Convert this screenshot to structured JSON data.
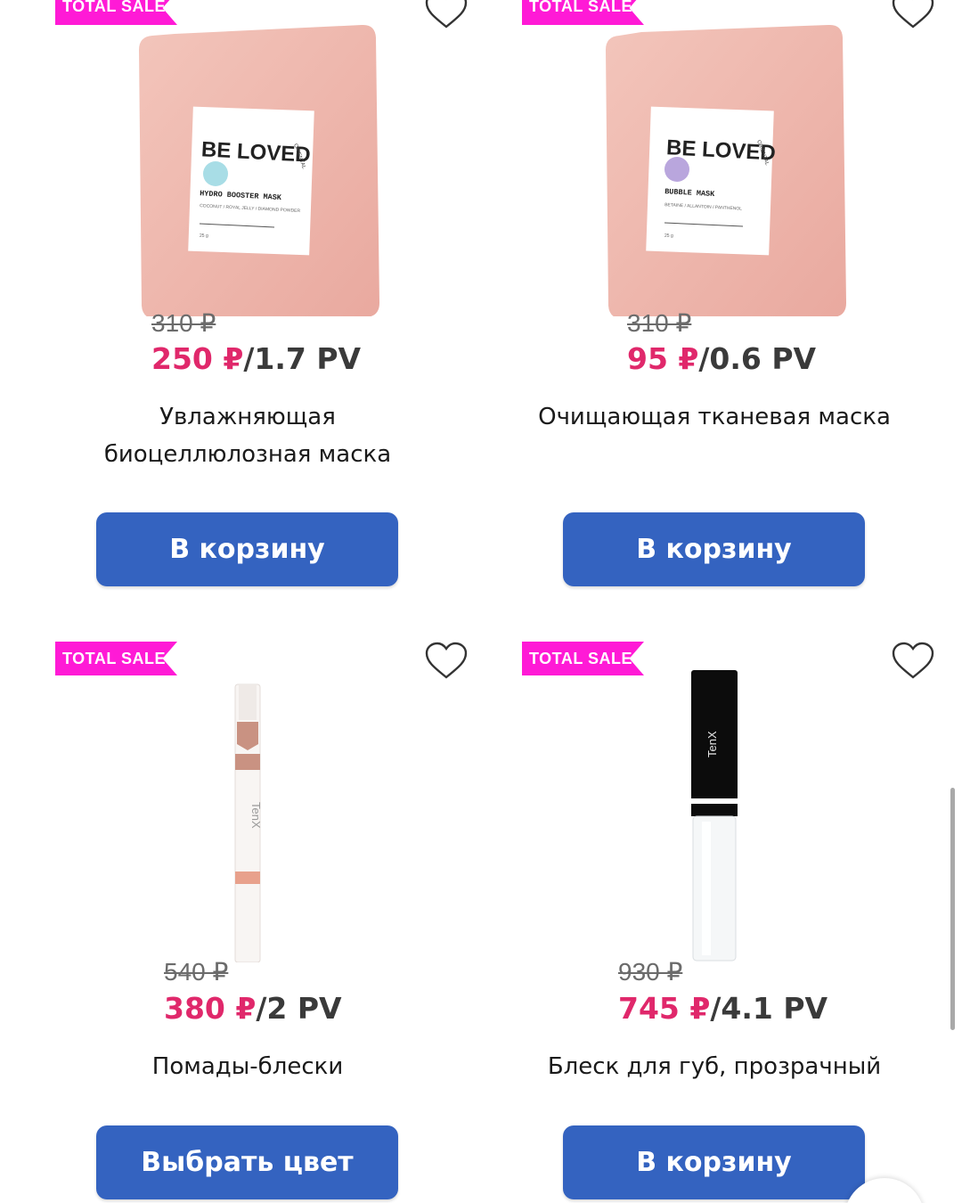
{
  "accent_colors": {
    "sale_badge": "#ff1ad6",
    "price_now": "#e0286b",
    "button": "#3463c0"
  },
  "products": [
    {
      "badge": "TOTAL SALE",
      "package_brand": "BE LOVED",
      "package_sub": "ORIENTAL",
      "package_name": "HYDRO BOOSTER MASK",
      "package_ingredients": "COCONUT / ROYAL JELLY / DIAMOND POWDER",
      "package_weight": "25 g",
      "old_price": "310 ₽",
      "price": "250 ₽",
      "pv": "/1.7 PV",
      "title_lines": [
        "Увлажняющая",
        "биоцеллюлозная маска"
      ],
      "button_label": "В корзину",
      "favorite_icon": "heart-outline-icon"
    },
    {
      "badge": "TOTAL SALE",
      "package_brand": "BE LOVED",
      "package_sub": "ORIENTAL",
      "package_name": "BUBBLE MASK",
      "package_ingredients": "BETAINE / ALLANTOIN / PANTHENOL",
      "package_weight": "25 g",
      "old_price": "310 ₽",
      "price": "95 ₽",
      "pv": "/0.6 PV",
      "title_lines": [
        "Очищающая тканевая маска"
      ],
      "button_label": "В корзину",
      "favorite_icon": "heart-outline-icon"
    },
    {
      "badge": "TOTAL SALE",
      "package_brand": "TenX",
      "old_price": "540 ₽",
      "price": "380 ₽",
      "pv": "/2 PV",
      "title_lines": [
        "Помады-блески"
      ],
      "button_label": "Выбрать цвет",
      "favorite_icon": "heart-outline-icon"
    },
    {
      "badge": "TOTAL SALE",
      "package_brand": "TenX",
      "old_price": "930 ₽",
      "price": "745 ₽",
      "pv": "/4.1 PV",
      "title_lines": [
        "Блеск для губ, прозрачный"
      ],
      "button_label": "В корзину",
      "favorite_icon": "heart-outline-icon"
    }
  ]
}
